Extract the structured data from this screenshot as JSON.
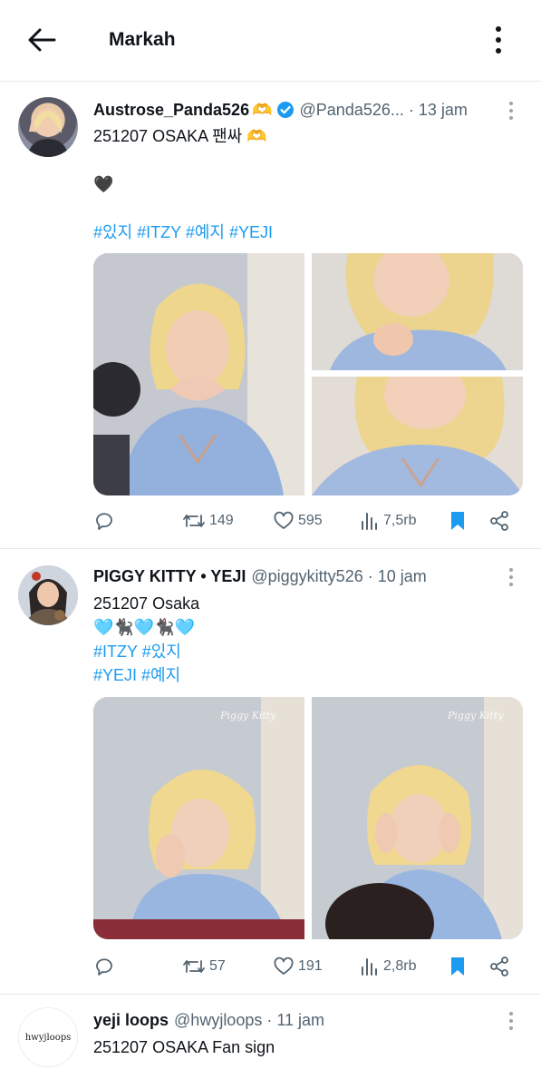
{
  "header": {
    "title": "Markah"
  },
  "tweets": [
    {
      "name": "Austrose_Panda526",
      "name_emoji": "🫶",
      "handle": "@Panda526...",
      "time": "13 jam",
      "line1": "251207  OSAKA 팬싸 🫶",
      "line2": "🖤",
      "tags": [
        "#있지",
        "#ITZY",
        "#예지",
        "#YEJI"
      ],
      "image_count": 3,
      "replies": "",
      "retweets": "149",
      "likes": "595",
      "views": "7,5rb",
      "bookmarked": true,
      "colors": {
        "verified": "#1d9bf0"
      }
    },
    {
      "name": "PIGGY KITTY • YEJI",
      "handle": "@piggykitty526",
      "time": "10 jam",
      "line1": "251207 Osaka",
      "line2": "🩵🐈‍⬛🩵🐈‍⬛🩵",
      "tags_line1": [
        "#ITZY",
        "#있지"
      ],
      "tags_line2": [
        "#YEJI",
        "#예지"
      ],
      "watermark": "Piggy Kitty",
      "image_count": 2,
      "retweets": "57",
      "likes": "191",
      "views": "2,8rb",
      "bookmarked": true
    },
    {
      "name": "yeji loops",
      "handle": "@hwyjloops",
      "time": "11 jam",
      "avatar_text": "hwyjloops",
      "line1": "251207 OSAKA Fan sign"
    }
  ],
  "icons": [
    "back-arrow-icon",
    "more-vertical-icon",
    "verified-badge-icon",
    "reply-icon",
    "retweet-icon",
    "like-icon",
    "views-icon",
    "bookmark-icon",
    "share-icon"
  ],
  "colors": {
    "accent": "#1d9bf0",
    "text": "#0f1419",
    "muted": "#536471",
    "divider": "#e6e9ec"
  }
}
